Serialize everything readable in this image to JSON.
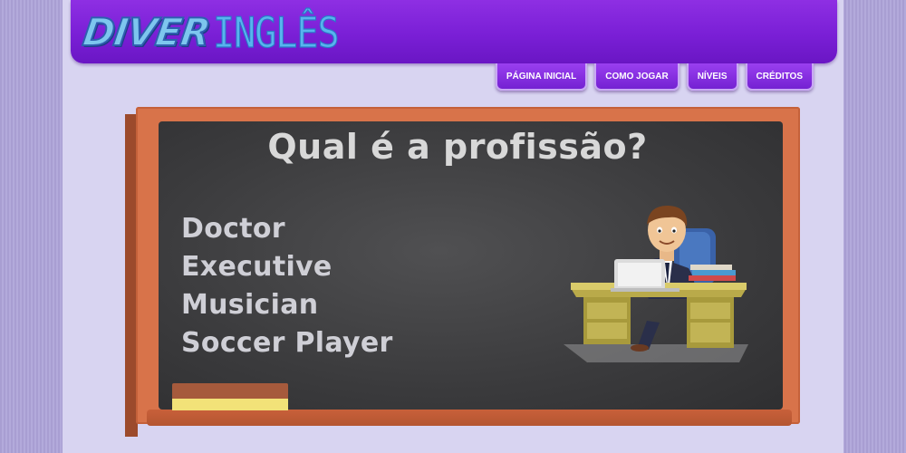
{
  "header": {
    "logo_part1": "DIVER",
    "logo_part2": "INGLÊS"
  },
  "nav": {
    "items": [
      {
        "label": "PÁGINA INICIAL"
      },
      {
        "label": "COMO JOGAR"
      },
      {
        "label": "NÍVEIS"
      },
      {
        "label": "CRÉDITOS"
      }
    ]
  },
  "quiz": {
    "question": "Qual é a profissão?",
    "options": [
      "Doctor",
      "Executive",
      "Musician",
      "Soccer Player"
    ],
    "illustration_icon": "executive-at-desk-illustration"
  },
  "colors": {
    "header": "#7a1fd6",
    "board": "#3b3b3d",
    "frame": "#d8734a",
    "page_bg": "#d8d4f1"
  }
}
